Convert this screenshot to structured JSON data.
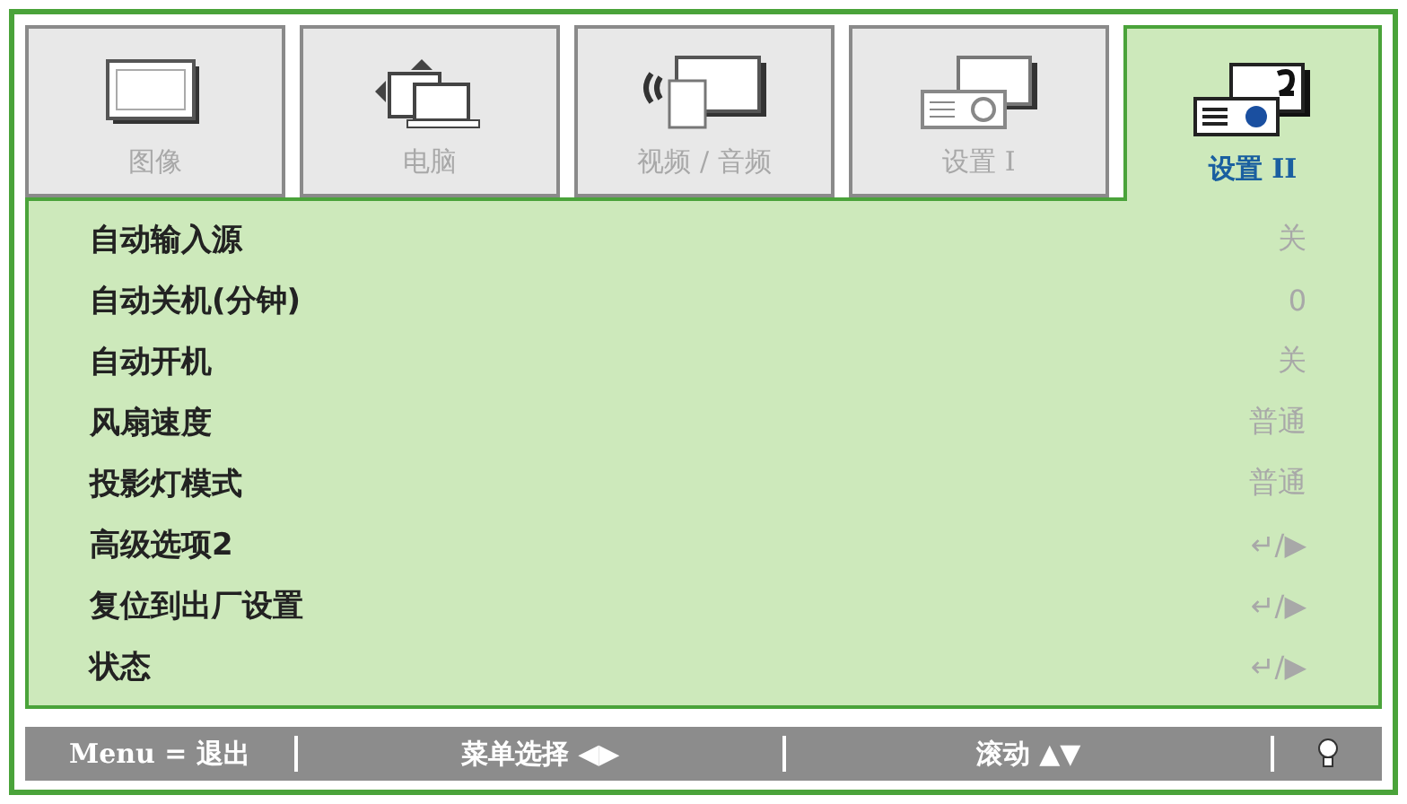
{
  "tabs": [
    {
      "label": "图像",
      "kind": "monitor",
      "selected": false
    },
    {
      "label": "电脑",
      "kind": "computer",
      "selected": false
    },
    {
      "label": "视频 / 音频",
      "kind": "video",
      "selected": false
    },
    {
      "label": "设置 I",
      "kind": "setup1",
      "selected": false
    },
    {
      "label": "设置 II",
      "kind": "setup2",
      "selected": true
    }
  ],
  "rows": [
    {
      "label": "自动输入源",
      "value": "关"
    },
    {
      "label": "自动关机(分钟)",
      "value": "0"
    },
    {
      "label": "自动开机",
      "value": "关"
    },
    {
      "label": "风扇速度",
      "value": "普通"
    },
    {
      "label": "投影灯模式",
      "value": "普通"
    },
    {
      "label": "高级选项2",
      "value": "↵/▶"
    },
    {
      "label": "复位到出厂设置",
      "value": "↵/▶"
    },
    {
      "label": "状态",
      "value": "↵/▶"
    }
  ],
  "status_bar": {
    "items": [
      "Menu = 退出",
      "菜单选择 ◀▶",
      "滚动 ▲▼"
    ]
  }
}
